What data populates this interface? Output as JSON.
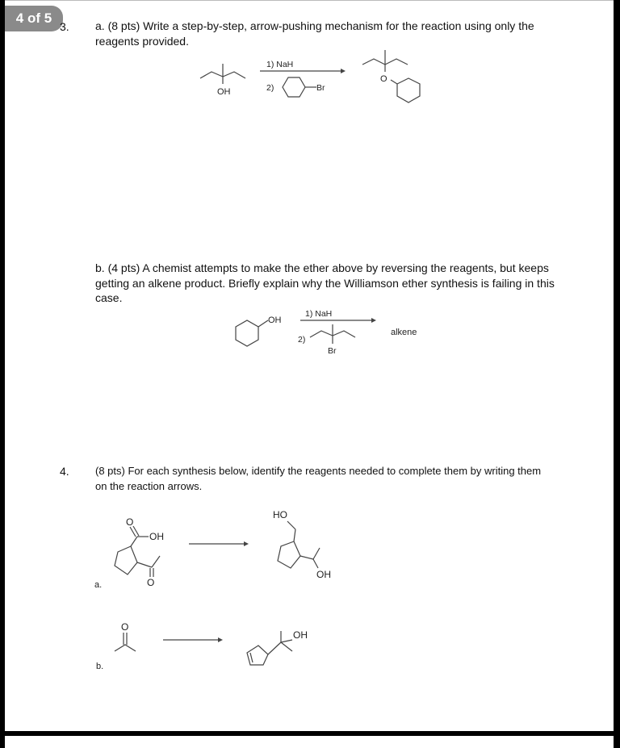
{
  "page_indicator": "4 of 5",
  "questions": [
    {
      "number": "3.",
      "part_a": {
        "text": "a. (8 pts) Write a step-by-step, arrow-pushing mechanism for the reaction using only the reagents provided.",
        "reaction": {
          "reactant_label": "OH",
          "reagent_1": "1) NaH",
          "reagent_2_prefix": "2)",
          "reagent_2_label": "Br",
          "product_label": "O"
        }
      },
      "part_b": {
        "text": "b. (4 pts) A chemist attempts to make the ether above by reversing the reagents, but keeps getting an alkene product. Briefly explain why the Williamson ether synthesis is failing in this case.",
        "reaction": {
          "reactant_label": "OH",
          "reagent_1": "1) NaH",
          "reagent_2_prefix": "2)",
          "reagent_2_label": "Br",
          "product_text": "alkene"
        }
      }
    },
    {
      "number": "4.",
      "text": "(8 pts) For each synthesis below, identify the reagents needed to complete them by writing them on the reaction arrows.",
      "syntheses": [
        {
          "label": "a.",
          "reactant_labels": {
            "carbonyl_o": "O",
            "acid_oh": "OH",
            "ketone_o": "O"
          },
          "product_labels": {
            "ho": "HO",
            "oh": "OH"
          }
        },
        {
          "label": "b.",
          "reactant_labels": {
            "carbonyl_o": "O"
          },
          "product_labels": {
            "oh": "OH"
          }
        }
      ]
    }
  ]
}
